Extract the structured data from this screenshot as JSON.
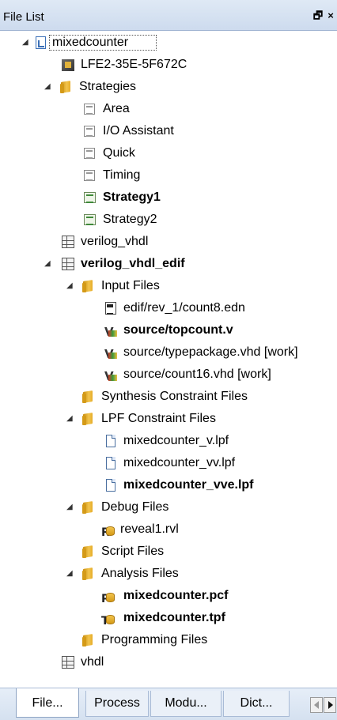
{
  "panel": {
    "title": "File List",
    "controls": {
      "float": "🗗",
      "close": "×"
    }
  },
  "tree": {
    "items": [
      {
        "label": "mixedcounter",
        "icon": "project-icon",
        "expander": "◢",
        "expanded": true,
        "bold": false,
        "selected": true
      },
      {
        "label": "LFE2-35E-5F672C",
        "icon": "device-chip-icon",
        "bold": false
      },
      {
        "label": "Strategies",
        "icon": "folder-icon",
        "expander": "◢",
        "expanded": true,
        "bold": false
      },
      {
        "label": "Area",
        "icon": "strategy-icon",
        "bold": false
      },
      {
        "label": "I/O Assistant",
        "icon": "strategy-icon",
        "bold": false
      },
      {
        "label": "Quick",
        "icon": "strategy-icon",
        "bold": false
      },
      {
        "label": "Timing",
        "icon": "strategy-icon",
        "bold": false
      },
      {
        "label": "Strategy1",
        "icon": "custom-strategy-icon",
        "bold": true
      },
      {
        "label": "Strategy2",
        "icon": "custom-strategy-icon",
        "bold": false
      },
      {
        "label": "verilog_vhdl",
        "icon": "implementation-icon",
        "bold": false
      },
      {
        "label": "verilog_vhdl_edif",
        "icon": "implementation-icon",
        "expander": "◢",
        "expanded": true,
        "bold": true
      },
      {
        "label": "Input Files",
        "icon": "folder-icon",
        "expander": "◢",
        "expanded": true,
        "bold": false
      },
      {
        "label": "edif/rev_1/count8.edn",
        "icon": "edif-file-icon",
        "bold": false
      },
      {
        "label": "source/topcount.v",
        "icon": "verilog-file-icon",
        "bold": true
      },
      {
        "label": "source/typepackage.vhd [work]",
        "icon": "vhdl-file-icon",
        "bold": false
      },
      {
        "label": "source/count16.vhd [work]",
        "icon": "vhdl-file-icon",
        "bold": false
      },
      {
        "label": "Synthesis Constraint Files",
        "icon": "folder-icon",
        "bold": false
      },
      {
        "label": "LPF Constraint Files",
        "icon": "folder-icon",
        "expander": "◢",
        "expanded": true,
        "bold": false
      },
      {
        "label": "mixedcounter_v.lpf",
        "icon": "document-icon",
        "bold": false
      },
      {
        "label": "mixedcounter_vv.lpf",
        "icon": "document-icon",
        "bold": false
      },
      {
        "label": "mixedcounter_vve.lpf",
        "icon": "document-icon",
        "bold": true
      },
      {
        "label": "Debug Files",
        "icon": "folder-icon",
        "expander": "◢",
        "expanded": true,
        "bold": false
      },
      {
        "label": "reveal1.rvl",
        "icon": "reveal-file-icon",
        "letter": "R",
        "bold": false
      },
      {
        "label": "Script Files",
        "icon": "folder-icon",
        "bold": false
      },
      {
        "label": "Analysis Files",
        "icon": "folder-icon",
        "expander": "◢",
        "expanded": true,
        "bold": false
      },
      {
        "label": "mixedcounter.pcf",
        "icon": "power-calc-file-icon",
        "letter": "P",
        "bold": true
      },
      {
        "label": "mixedcounter.tpf",
        "icon": "timing-file-icon",
        "letter": "T",
        "bold": true
      },
      {
        "label": "Programming Files",
        "icon": "folder-icon",
        "bold": false
      },
      {
        "label": "vhdl",
        "icon": "implementation-icon",
        "bold": false
      }
    ]
  },
  "tabs": [
    {
      "label": "File...",
      "active": true
    },
    {
      "label": "Process",
      "active": false
    },
    {
      "label": "Modu...",
      "active": false
    },
    {
      "label": "Dict...",
      "active": false
    }
  ],
  "colors": {
    "title_bg": "#dfe9f5",
    "tab_bg": "#eaf0f8",
    "folder": "#f2c44d"
  }
}
